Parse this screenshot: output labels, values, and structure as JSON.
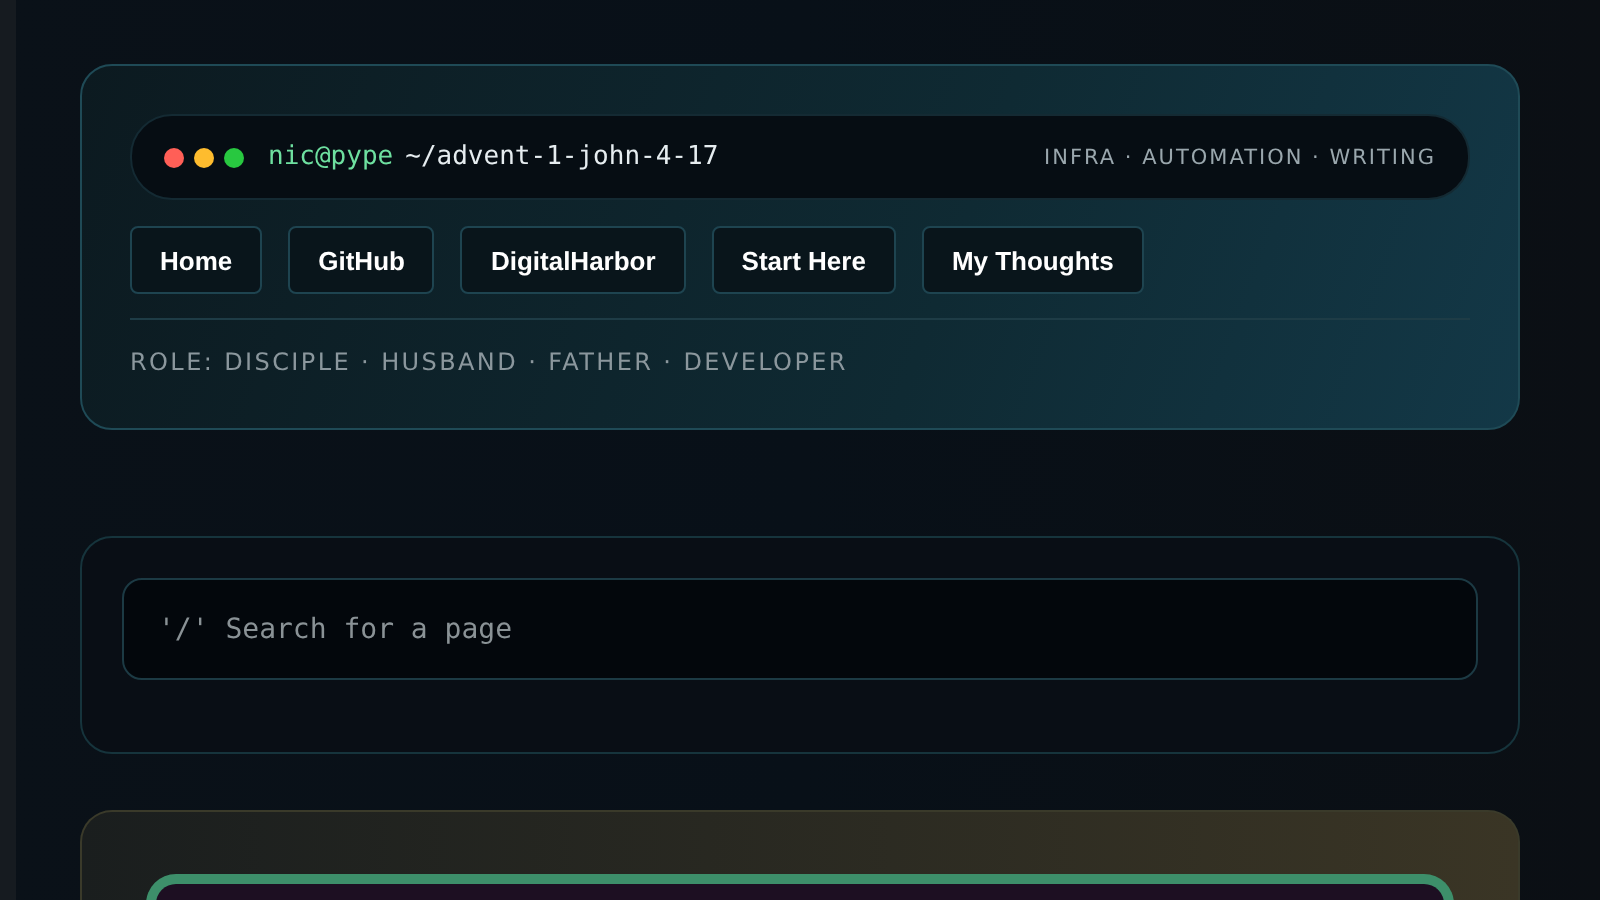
{
  "header": {
    "prompt_user": "nic@pype",
    "prompt_path": "~/advent-1-john-4-17",
    "tagline": "INFRA · AUTOMATION · WRITING",
    "nav": [
      {
        "label": "Home"
      },
      {
        "label": "GitHub"
      },
      {
        "label": "DigitalHarbor"
      },
      {
        "label": "Start Here"
      },
      {
        "label": "My Thoughts"
      }
    ],
    "role": "ROLE: DISCIPLE · HUSBAND · FATHER · DEVELOPER"
  },
  "search": {
    "placeholder": "'/' Search for a page"
  }
}
